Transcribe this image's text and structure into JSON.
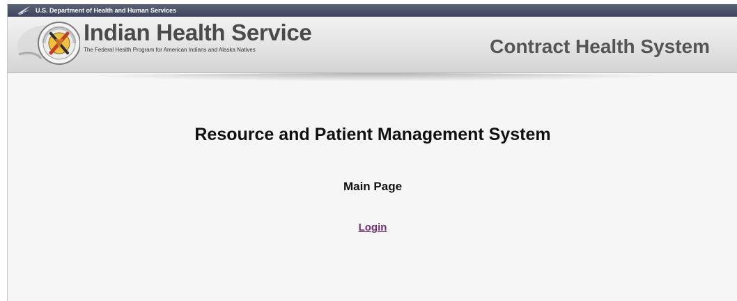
{
  "header": {
    "department": "U.S. Department of Health and Human Services",
    "agency_name": "Indian Health Service",
    "agency_tagline": "The Federal Health Program for American Indians and Alaska Natives",
    "system_name": "Contract Health System",
    "icons": [
      "hhs-eagle-icon",
      "ihs-seal-logo"
    ]
  },
  "main": {
    "title": "Resource and Patient Management System",
    "subtitle": "Main Page",
    "login_label": "Login"
  },
  "colors": {
    "hhs_bar": "#4a5168",
    "link_visited": "#7a2a7a",
    "title_text": "#4a4a4a",
    "system_text": "#555555"
  }
}
